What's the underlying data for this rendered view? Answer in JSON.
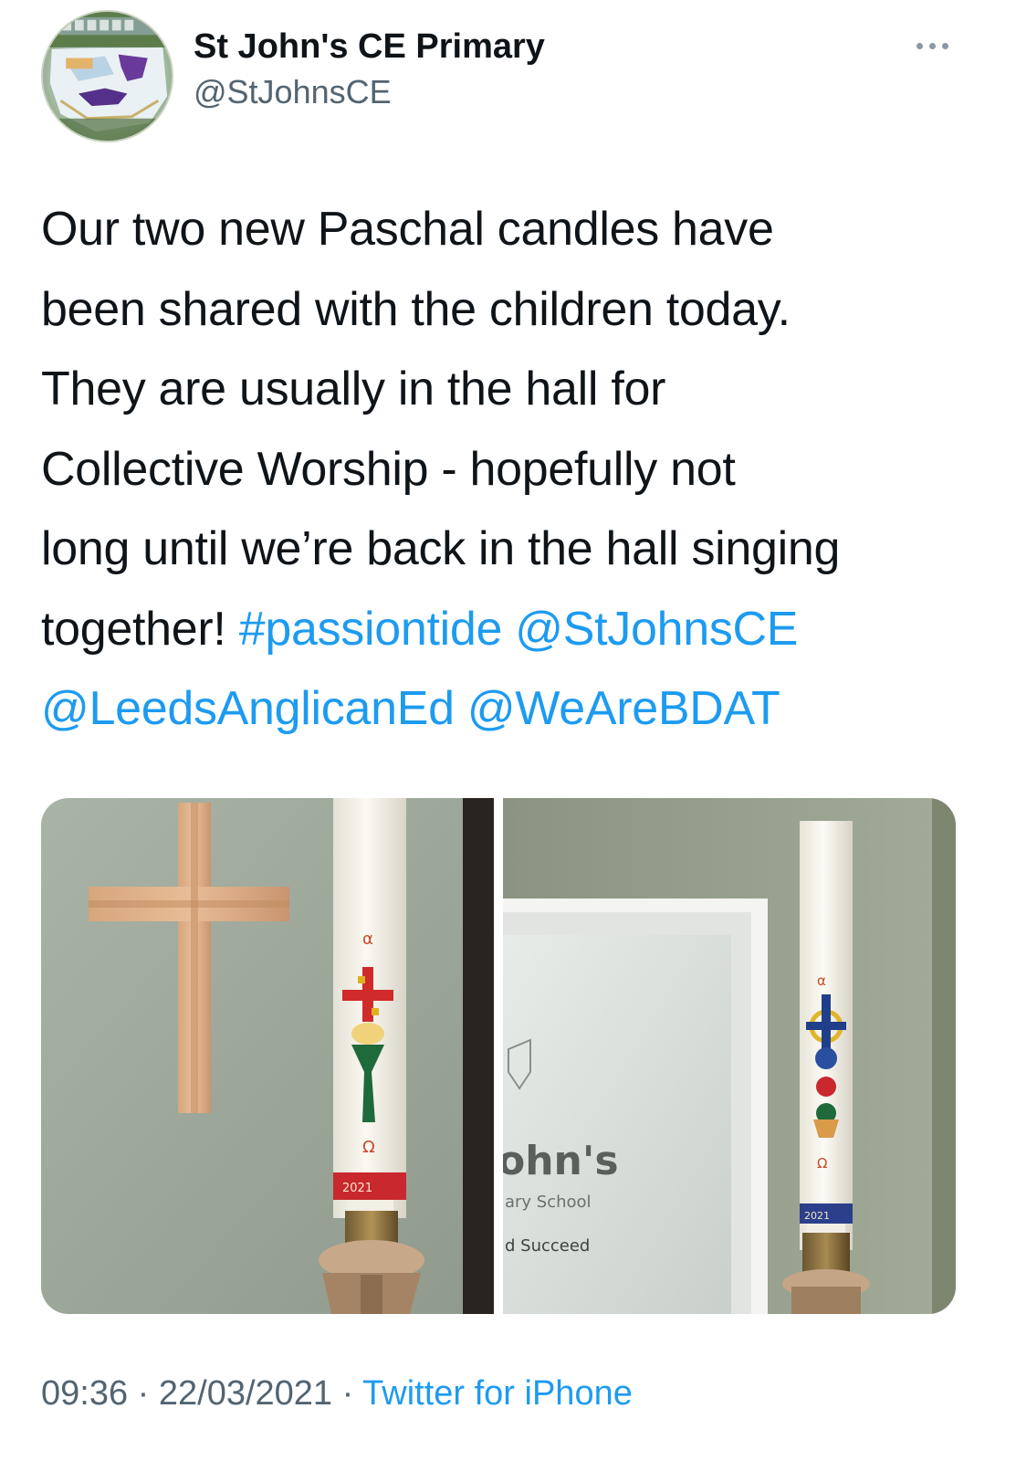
{
  "tweet": {
    "author": {
      "display_name": "St John's CE Primary",
      "handle": "@StJohnsCE"
    },
    "text_lines": [
      [
        {
          "t": "Our two new Paschal candles have",
          "link": false
        }
      ],
      [
        {
          "t": "been shared with the children today.",
          "link": false
        }
      ],
      [
        {
          "t": "They are usually in the hall for",
          "link": false
        }
      ],
      [
        {
          "t": "Collective Worship - hopefully not",
          "link": false
        }
      ],
      [
        {
          "t": "long until we’re back in the hall singing",
          "link": false
        }
      ],
      [
        {
          "t": "together! ",
          "link": false
        },
        {
          "t": "#passiontide",
          "link": true
        },
        {
          "t": " ",
          "link": false
        },
        {
          "t": "@StJohnsCE",
          "link": true
        }
      ],
      [
        {
          "t": "@LeedsAnglicanEd",
          "link": true
        },
        {
          "t": " ",
          "link": false
        },
        {
          "t": "@WeAreBDAT",
          "link": true
        }
      ]
    ],
    "media": {
      "photo1": {
        "candle_year": "2021"
      },
      "photo2": {
        "sign_text": [
          "ohn's",
          "ary School",
          "d Succeed"
        ],
        "candle_year": "2021"
      }
    },
    "meta": {
      "time": "09:36",
      "separator": " · ",
      "date": "22/03/2021",
      "source": "Twitter for iPhone"
    }
  },
  "colors": {
    "link": "#1d9bf0",
    "secondary_text": "#536471",
    "primary_text": "#0f1419"
  },
  "icons": {
    "more": "more-horizontal-icon"
  }
}
